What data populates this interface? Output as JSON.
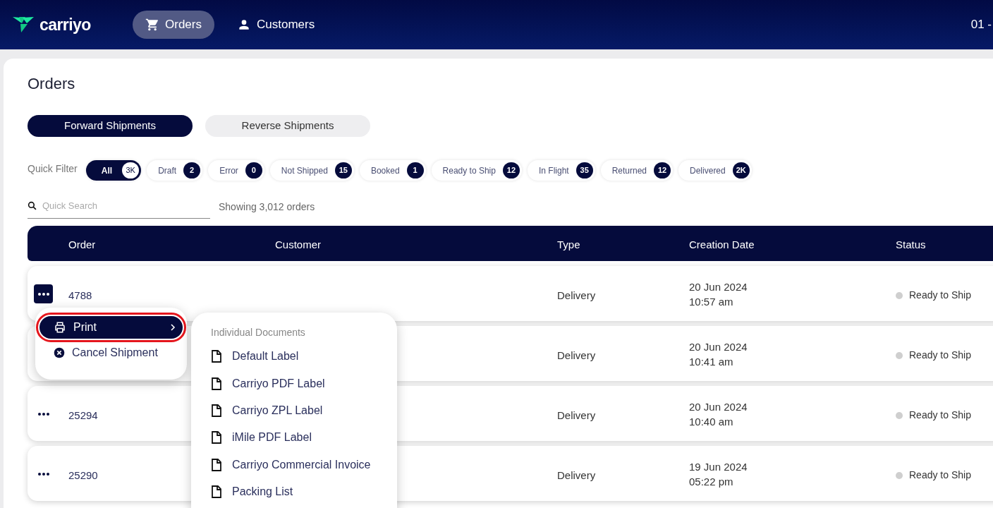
{
  "header": {
    "logo_text": "carriyo",
    "nav": [
      {
        "label": "Orders",
        "selected": true
      },
      {
        "label": "Customers",
        "selected": false
      }
    ],
    "account": "01 -"
  },
  "page": {
    "title": "Orders",
    "tabs": [
      {
        "label": "Forward Shipments",
        "selected": true
      },
      {
        "label": "Reverse Shipments",
        "selected": false
      }
    ],
    "quick_filter": {
      "label": "Quick Filter",
      "chips": [
        {
          "label": "All",
          "count": "3K",
          "selected": true
        },
        {
          "label": "Draft",
          "count": "2",
          "selected": false
        },
        {
          "label": "Error",
          "count": "0",
          "selected": false
        },
        {
          "label": "Not Shipped",
          "count": "15",
          "selected": false
        },
        {
          "label": "Booked",
          "count": "1",
          "selected": false
        },
        {
          "label": "Ready to Ship",
          "count": "12",
          "selected": false
        },
        {
          "label": "In Flight",
          "count": "35",
          "selected": false
        },
        {
          "label": "Returned",
          "count": "12",
          "selected": false
        },
        {
          "label": "Delivered",
          "count": "2K",
          "selected": false
        }
      ]
    },
    "search": {
      "placeholder": "Quick Search"
    },
    "result_count": "Showing 3,012 orders",
    "table": {
      "columns": [
        "Order",
        "Customer",
        "Type",
        "Creation Date",
        "Status"
      ],
      "rows": [
        {
          "order": "4788",
          "type": "Delivery",
          "date": "20 Jun 2024",
          "time": "10:57 am",
          "status": "Ready to Ship",
          "menu_open": true
        },
        {
          "type": "Delivery",
          "date": "20 Jun 2024",
          "time": "10:41 am",
          "status": "Ready to Ship",
          "menu_open": false
        },
        {
          "order": "25294",
          "type": "Delivery",
          "date": "20 Jun 2024",
          "time": "10:40 am",
          "status": "Ready to Ship",
          "menu_open": false
        },
        {
          "order": "25290",
          "type": "Delivery",
          "date": "19 Jun 2024",
          "time": "05:22 pm",
          "status": "Ready to Ship",
          "menu_open": false
        }
      ]
    },
    "action_menu": {
      "items": [
        {
          "label": "Print",
          "has_submenu": true,
          "selected": true,
          "highlighted": true
        },
        {
          "label": "Cancel Shipment",
          "has_submenu": false,
          "selected": false,
          "highlighted": false
        }
      ]
    },
    "print_submenu": {
      "heading": "Individual Documents",
      "items": [
        "Default Label",
        "Carriyo PDF Label",
        "Carriyo ZPL Label",
        "iMile PDF Label",
        "Carriyo Commercial Invoice",
        "Packing List"
      ]
    }
  }
}
